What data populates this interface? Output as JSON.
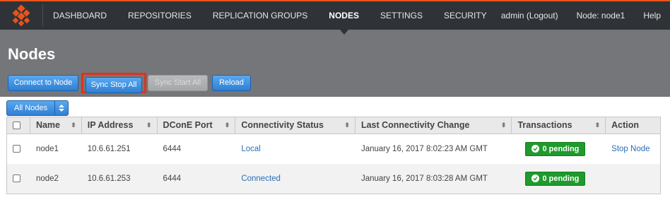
{
  "nav": {
    "items": [
      {
        "label": "DASHBOARD",
        "active": false
      },
      {
        "label": "REPOSITORIES",
        "active": false
      },
      {
        "label": "REPLICATION GROUPS",
        "active": false
      },
      {
        "label": "NODES",
        "active": true
      },
      {
        "label": "SETTINGS",
        "active": false
      },
      {
        "label": "SECURITY",
        "active": false
      }
    ],
    "user": "admin (Logout)",
    "node": "Node: node1",
    "help": "Help"
  },
  "page": {
    "title": "Nodes"
  },
  "toolbar": {
    "connect_label": "Connect to Node",
    "sync_stop_label": "Sync Stop All",
    "sync_start_label": "Sync Start All",
    "reload_label": "Reload"
  },
  "filter": {
    "selected": "All Nodes"
  },
  "table": {
    "headers": [
      "Name",
      "IP Address",
      "DConE Port",
      "Connectivity Status",
      "Last Connectivity Change",
      "Transactions",
      "Action"
    ],
    "rows": [
      {
        "name": "node1",
        "ip": "10.6.61.251",
        "port": "6444",
        "status": "Local",
        "last_change": "January 16, 2017 8:02:23 AM GMT",
        "transactions": "0 pending",
        "action": "Stop Node"
      },
      {
        "name": "node2",
        "ip": "10.6.61.253",
        "port": "6444",
        "status": "Connected",
        "last_change": "January 16, 2017 8:03:28 AM GMT",
        "transactions": "0 pending",
        "action": ""
      }
    ]
  },
  "colors": {
    "accent": "#e8541e",
    "primary_button": "#2f7fd4",
    "pending_badge": "#1f9a2c",
    "highlight_border": "#e0321e"
  }
}
